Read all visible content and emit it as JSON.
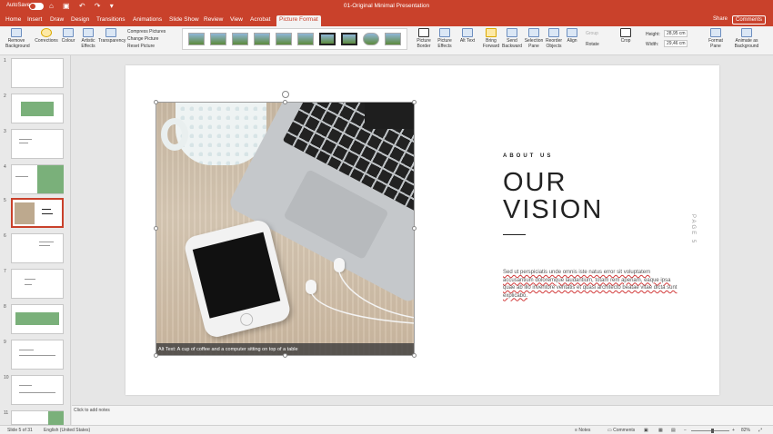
{
  "titlebar": {
    "autosave": "AutoSave",
    "toggle": "OFF",
    "doc_title": "01-Original Minimal Presentation"
  },
  "tabs": [
    {
      "label": "Home"
    },
    {
      "label": "Insert"
    },
    {
      "label": "Draw"
    },
    {
      "label": "Design"
    },
    {
      "label": "Transitions"
    },
    {
      "label": "Animations"
    },
    {
      "label": "Slide Show"
    },
    {
      "label": "Review"
    },
    {
      "label": "View"
    },
    {
      "label": "Acrobat"
    },
    {
      "label": "Picture Format"
    }
  ],
  "header_actions": {
    "share": "Share",
    "comments": "Comments"
  },
  "ribbon": {
    "remove_background": "Remove Background",
    "corrections": "Corrections",
    "colour": "Colour",
    "artistic_effects": "Artistic Effects",
    "transparency": "Transparency",
    "compress": "Compress Pictures",
    "change": "Change Picture",
    "reset": "Reset Picture",
    "picture_border": "Picture Border",
    "picture_effects": "Picture Effects",
    "alt_text": "Alt Text",
    "bring_forward": "Bring Forward",
    "send_backward": "Send Backward",
    "selection_pane": "Selection Pane",
    "reorder_objects": "Reorder Objects",
    "align": "Align",
    "group": "Group",
    "rotate": "Rotate",
    "crop": "Crop",
    "height_label": "Height:",
    "height_value": "28,95 cm",
    "width_label": "Width:",
    "width_value": "29,46 cm",
    "format_pane": "Format Pane",
    "animate_as_background": "Animate as Background"
  },
  "slides": [
    {
      "num": "1"
    },
    {
      "num": "2"
    },
    {
      "num": "3"
    },
    {
      "num": "4"
    },
    {
      "num": "5"
    },
    {
      "num": "6"
    },
    {
      "num": "7"
    },
    {
      "num": "8"
    },
    {
      "num": "9"
    },
    {
      "num": "10"
    },
    {
      "num": "11"
    }
  ],
  "slide": {
    "alt_caption": "Alt Text: A cup of coffee and a computer sitting on top of a table",
    "about": "ABOUT US",
    "heading_line1": "OUR",
    "heading_line2": "VISION",
    "body": "Sed ut perspiciatis unde omnis iste natus error sit voluptatem accusantium doloremque laudantium, totam rem aperiam, eaque ipsa quae ab illo inventore veritatis et quasi architecto beatae vitae dicta sunt explicabo.",
    "page_label": "PAGE 5"
  },
  "notes": {
    "placeholder": "Click to add notes"
  },
  "status": {
    "slide_of": "Slide 5 of 31",
    "language": "English (United States)",
    "notes": "Notes",
    "comments": "Comments",
    "zoom": "82%"
  },
  "colors": {
    "accent": "#c9412b",
    "slide_green": "#7ab07a"
  }
}
